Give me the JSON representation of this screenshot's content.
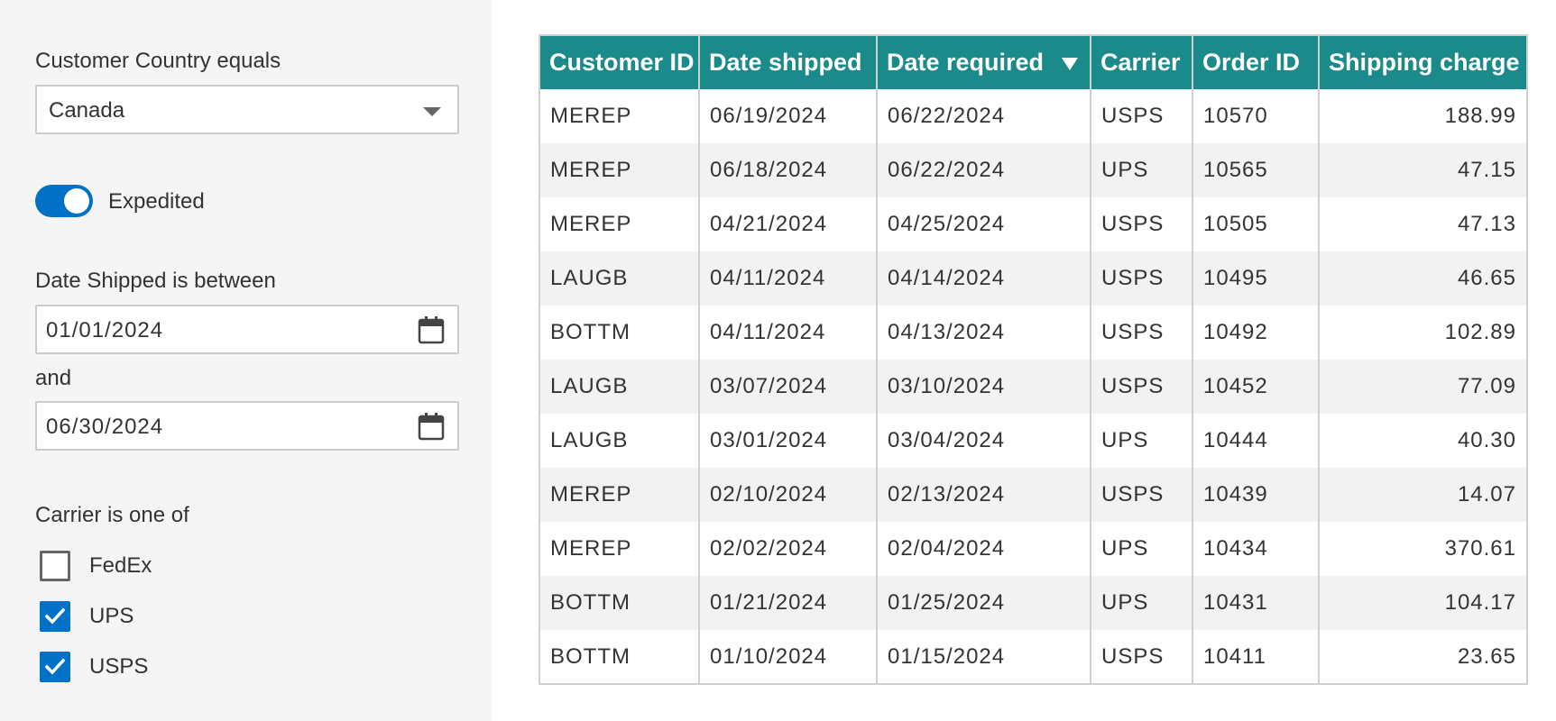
{
  "filters": {
    "country": {
      "label": "Customer Country equals",
      "value": "Canada"
    },
    "expedited": {
      "label": "Expedited",
      "on": true
    },
    "date_shipped": {
      "label": "Date Shipped is between",
      "from": "01/01/2024",
      "and_label": "and",
      "to": "06/30/2024"
    },
    "carrier": {
      "label": "Carrier is one of",
      "options": [
        {
          "label": "FedEx",
          "checked": false
        },
        {
          "label": "UPS",
          "checked": true
        },
        {
          "label": "USPS",
          "checked": true
        }
      ]
    }
  },
  "table": {
    "columns": [
      "Customer ID",
      "Date shipped",
      "Date required",
      "Carrier",
      "Order ID",
      "Shipping charge"
    ],
    "sorted_column": "Date required",
    "sort_direction": "descending",
    "rows": [
      [
        "MEREP",
        "06/19/2024",
        "06/22/2024",
        "USPS",
        "10570",
        "188.99"
      ],
      [
        "MEREP",
        "06/18/2024",
        "06/22/2024",
        "UPS",
        "10565",
        "47.15"
      ],
      [
        "MEREP",
        "04/21/2024",
        "04/25/2024",
        "USPS",
        "10505",
        "47.13"
      ],
      [
        "LAUGB",
        "04/11/2024",
        "04/14/2024",
        "USPS",
        "10495",
        "46.65"
      ],
      [
        "BOTTM",
        "04/11/2024",
        "04/13/2024",
        "USPS",
        "10492",
        "102.89"
      ],
      [
        "LAUGB",
        "03/07/2024",
        "03/10/2024",
        "USPS",
        "10452",
        "77.09"
      ],
      [
        "LAUGB",
        "03/01/2024",
        "03/04/2024",
        "UPS",
        "10444",
        "40.30"
      ],
      [
        "MEREP",
        "02/10/2024",
        "02/13/2024",
        "USPS",
        "10439",
        "14.07"
      ],
      [
        "MEREP",
        "02/02/2024",
        "02/04/2024",
        "UPS",
        "10434",
        "370.61"
      ],
      [
        "BOTTM",
        "01/21/2024",
        "01/25/2024",
        "UPS",
        "10431",
        "104.17"
      ],
      [
        "BOTTM",
        "01/10/2024",
        "01/15/2024",
        "USPS",
        "10411",
        "23.65"
      ]
    ]
  },
  "colors": {
    "accent": "#0072c6",
    "header": "#1a8a8a",
    "sidebar_bg": "#f5f5f5"
  }
}
